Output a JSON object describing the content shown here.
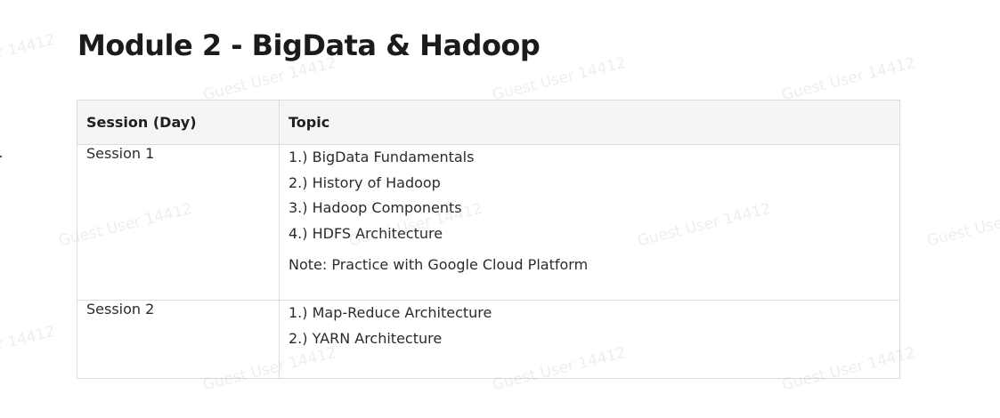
{
  "page": {
    "title": "Module 2 - BigData & Hadoop"
  },
  "table": {
    "headers": [
      "Session (Day)",
      "Topic"
    ],
    "rows": [
      {
        "session": "Session 1",
        "topics": [
          "1.) BigData Fundamentals",
          "2.) History of Hadoop",
          "3.) Hadoop Components",
          "4.) HDFS Architecture"
        ],
        "note": "Note: Practice with Google Cloud Platform"
      },
      {
        "session": "Session 2",
        "topics": [
          "1.) Map-Reduce Architecture",
          "2.) YARN Architecture"
        ],
        "note": ""
      }
    ]
  },
  "watermark": {
    "text": "Guest User 14412"
  }
}
